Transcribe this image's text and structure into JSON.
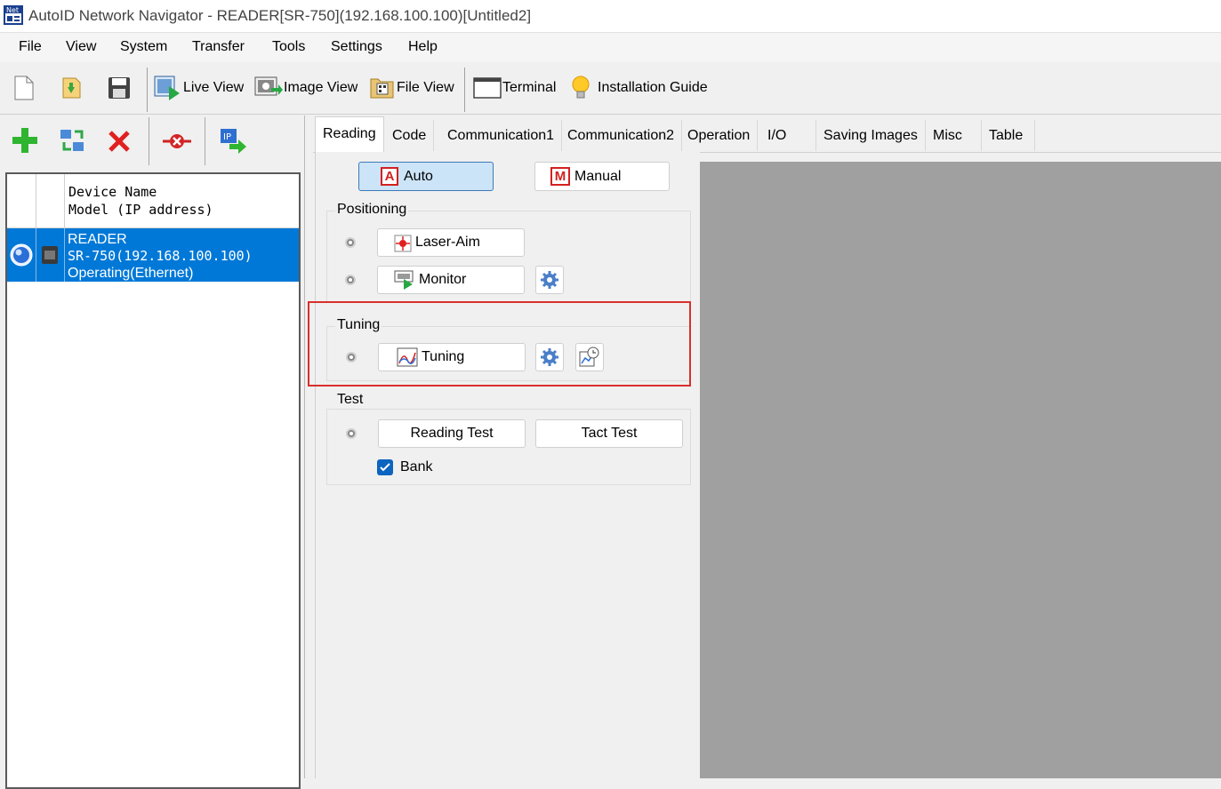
{
  "window": {
    "title": "AutoID Network Navigator - READER[SR-750](192.168.100.100)[Untitled2]",
    "app_icon": "net-app-icon"
  },
  "menu": [
    "File",
    "View",
    "System",
    "Transfer",
    "Tools",
    "Settings",
    "Help"
  ],
  "toolbar": {
    "live_view": "Live View",
    "image_view": "Image View",
    "file_view": "File View",
    "terminal": "Terminal",
    "installation_guide": "Installation Guide",
    "icons": [
      "new-file-icon",
      "open-file-icon",
      "save-icon",
      "live-view-icon",
      "image-view-icon",
      "file-view-icon",
      "terminal-icon",
      "lightbulb-icon"
    ]
  },
  "left_toolbar": {
    "icons": [
      "add-device-icon",
      "refresh-devices-icon",
      "delete-device-icon",
      "disconnect-icon",
      "ip-setting-icon"
    ]
  },
  "device_list": {
    "header_line1": "Device Name",
    "header_line2": "Model (IP address)",
    "devices": [
      {
        "name": "READER",
        "model": "SR-750(192.168.100.100)",
        "status": "Operating(Ethernet)"
      }
    ]
  },
  "tabs": [
    "Reading",
    "Code",
    "Communication1",
    "Communication2",
    "Operation",
    "I/O",
    "Saving Images",
    "Misc",
    "Table"
  ],
  "active_tab": "Reading",
  "reading": {
    "mode_auto": "Auto",
    "mode_manual": "Manual",
    "auto_letter": "A",
    "manual_letter": "M",
    "positioning_title": "Positioning",
    "laser_aim": "Laser-Aim",
    "monitor": "Monitor",
    "tuning_title": "Tuning",
    "tuning": "Tuning",
    "test_title": "Test",
    "reading_test": "Reading Test",
    "tact_test": "Tact Test",
    "bank": "Bank",
    "bank_checked": true
  },
  "colors": {
    "selection": "#0078d7",
    "highlight_box": "#d9302c",
    "preview_bg": "#a0a0a0",
    "pressed_button": "#cce4f7"
  }
}
